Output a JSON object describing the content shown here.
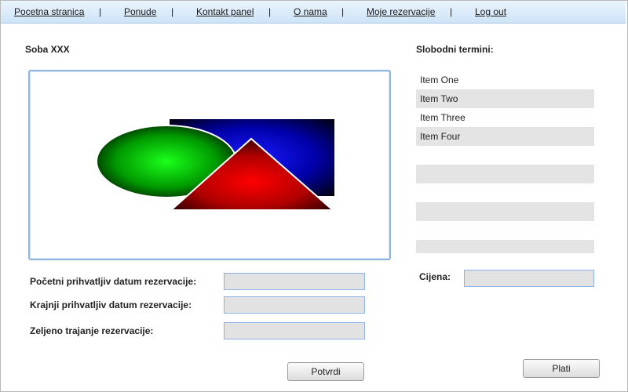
{
  "nav": {
    "items": [
      "Pocetna stranica",
      "Ponude",
      "Kontakt panel",
      "O nama",
      "Moje rezervacije",
      "Log out"
    ],
    "separator": "|"
  },
  "room": {
    "title": "Soba XXX"
  },
  "slots": {
    "title": "Slobodni termini:",
    "items": [
      "Item One",
      "Item Two",
      "Item Three",
      "Item Four",
      "",
      "",
      "",
      "",
      "",
      ""
    ]
  },
  "form": {
    "start_label": "Početni prihvatljiv datum rezervacije:",
    "end_label": "Krajnji prihvatljiv datum rezervacije:",
    "duration_label": "Zeljeno trajanje rezervacije:",
    "start_value": "",
    "end_value": "",
    "duration_value": "",
    "confirm_label": "Potvrdi"
  },
  "price": {
    "label": "Cijena:",
    "value": ""
  },
  "pay": {
    "label": "Plati"
  },
  "colors": {
    "nav_top": "#eaf4fd",
    "nav_bottom": "#cfe4f7",
    "input_bg": "#e2e2e2",
    "input_border": "#8fb0e8",
    "list_alt_bg": "#e4e4e4"
  }
}
